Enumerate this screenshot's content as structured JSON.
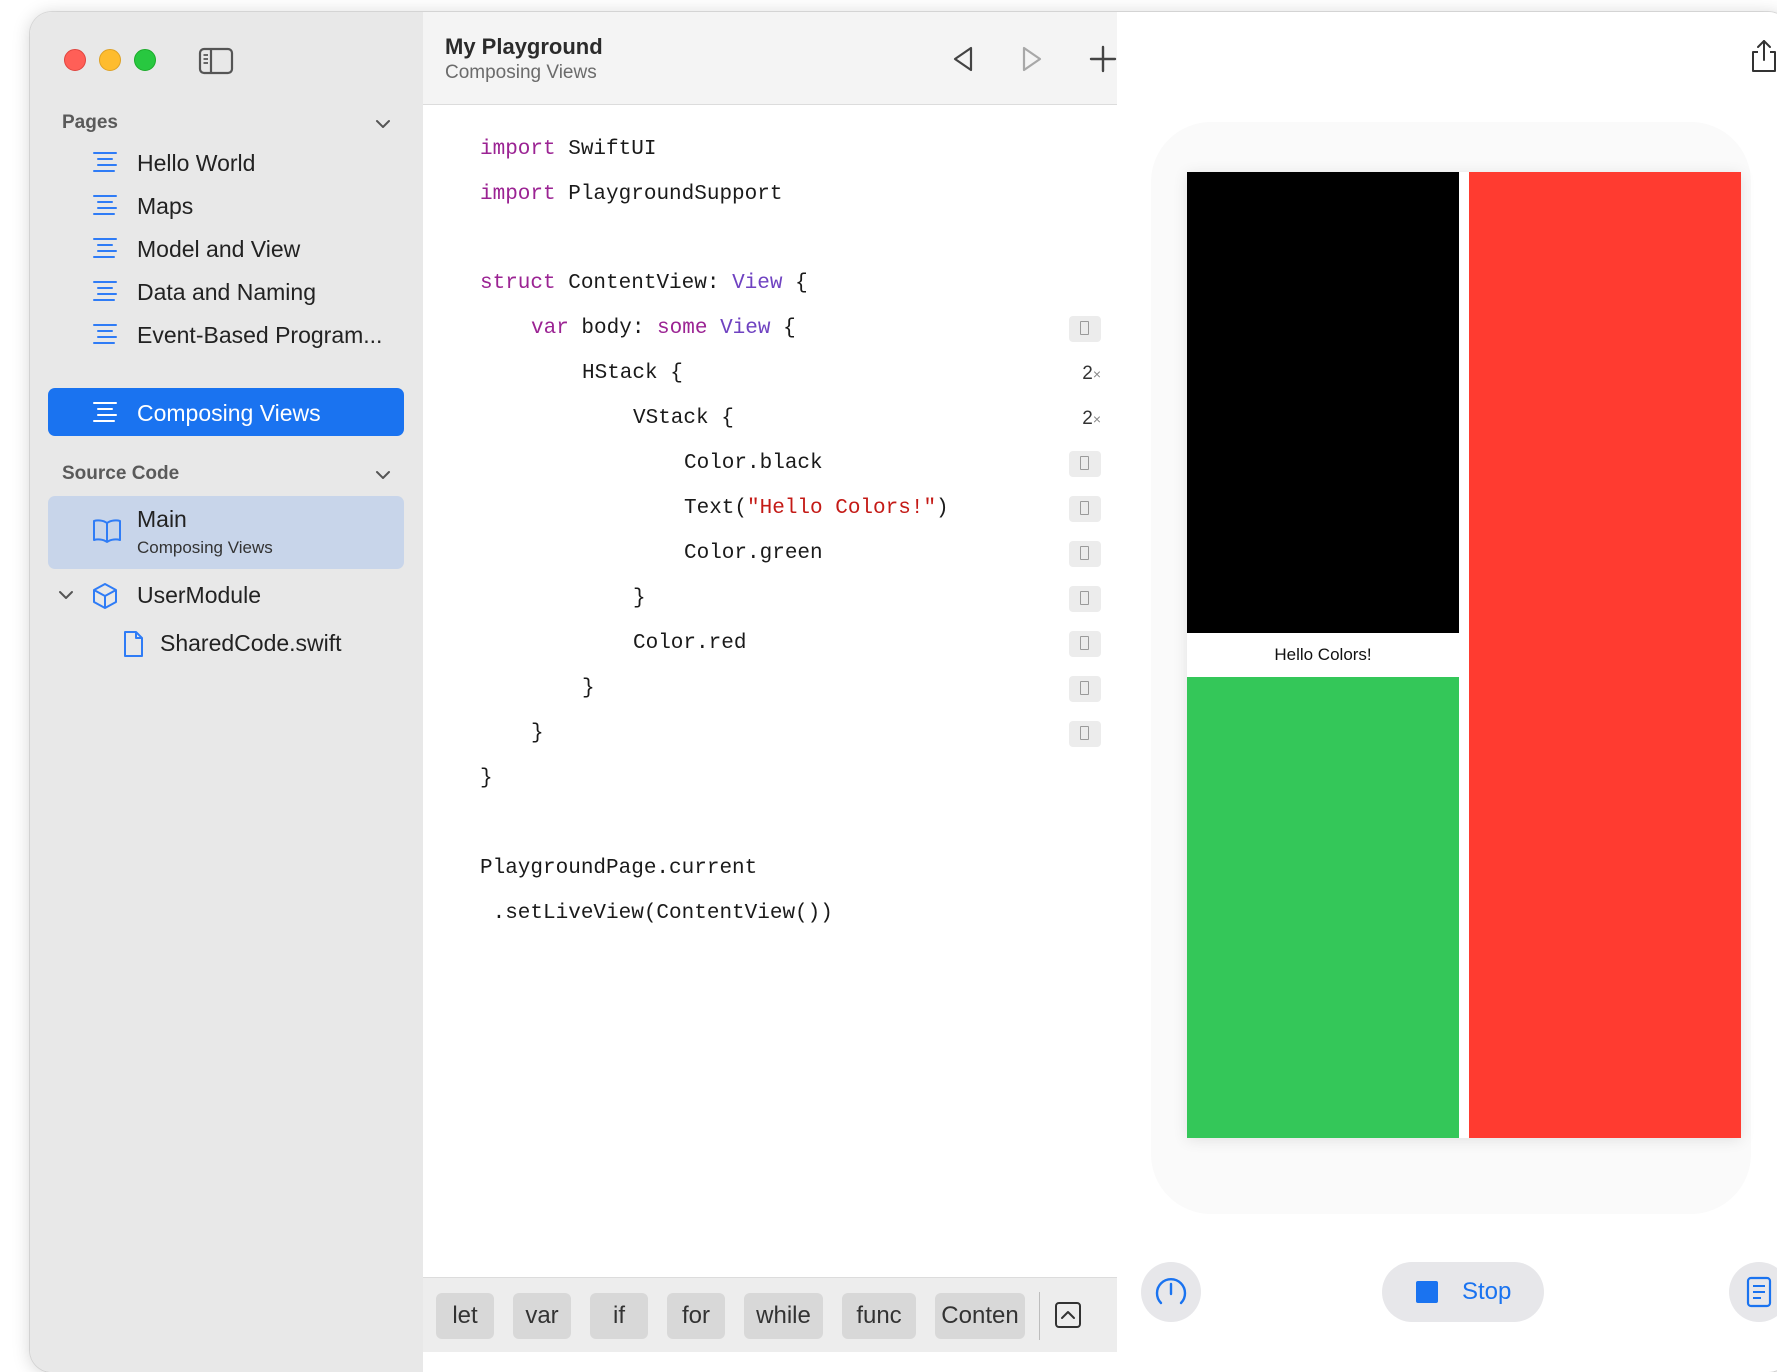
{
  "window": {
    "title": "My Playground",
    "subtitle": "Composing Views"
  },
  "sidebar": {
    "pages_header": "Pages",
    "pages": [
      {
        "label": "Hello World",
        "selected": false
      },
      {
        "label": "Maps",
        "selected": false
      },
      {
        "label": "Model and View",
        "selected": false
      },
      {
        "label": "Data and Naming",
        "selected": false
      },
      {
        "label": "Event-Based Program...",
        "selected": false
      },
      {
        "label": "Composing Views",
        "selected": true
      }
    ],
    "source_header": "Source Code",
    "main_item": {
      "title": "Main",
      "subtitle": "Composing Views"
    },
    "user_module": "UserModule",
    "shared_file": "SharedCode.swift"
  },
  "editor": {
    "code": {
      "l1_kw": "import",
      "l1_rest": " SwiftUI",
      "l2_kw": "import",
      "l2_rest": " PlaygroundSupport",
      "l4_kw": "struct",
      "l4_mid": " ContentView: ",
      "l4_ty": "View",
      "l4_end": " {",
      "l5_kw": "var",
      "l5_mid": " body: ",
      "l5_kw2": "some",
      "l5_sp": " ",
      "l5_ty": "View",
      "l5_end": " {",
      "l6": "HStack {",
      "l7": "VStack {",
      "l8": "Color.black",
      "l9_pre": "Text(",
      "l9_str": "\"Hello Colors!\"",
      "l9_end": ")",
      "l10": "Color.green",
      "l11": "}",
      "l12": "Color.red",
      "l13": "}",
      "l14": "}",
      "l15": "}",
      "l17": "PlaygroundPage.current",
      "l18": " .setLiveView(ContentView())"
    },
    "results": {
      "hstack_count": "2",
      "vstack_count": "2",
      "times_symbol": "×"
    },
    "shortcuts": [
      "let",
      "var",
      "if",
      "for",
      "while",
      "func",
      "Conten"
    ]
  },
  "preview": {
    "hello_text": "Hello Colors!",
    "stop_label": "Stop",
    "colors": {
      "black": "#000000",
      "green": "#34c759",
      "red": "#ff3b30",
      "accent": "#1a73f0"
    }
  }
}
